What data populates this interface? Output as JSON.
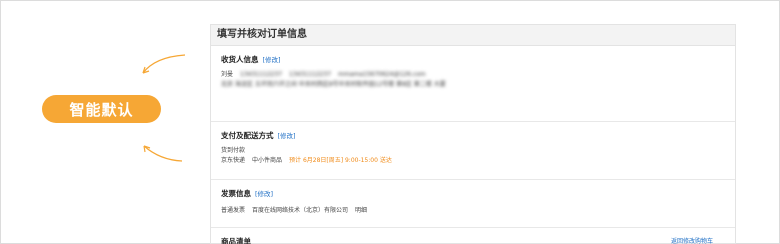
{
  "annotation": {
    "label": "智能默认"
  },
  "panel": {
    "title": "填写并核对订单信息"
  },
  "receiver": {
    "title": "收货人信息",
    "modify": "[修改]",
    "name": "刘曼",
    "phone1": "13431112237",
    "phone2": "13431112237",
    "email": "mmama15670624@126.com",
    "address": "北京 海淀区 五环到六环之间 中关村西区8号中关村软件园12号楼 第8区 第二楼 大厦"
  },
  "payment": {
    "title": "支付及配送方式",
    "modify": "[修改]",
    "pay_method": "货到付款",
    "carrier": "京东快递",
    "goods_type": "中小件商品",
    "eta": "预计 6月28日[周五] 9:00-15:00 送达"
  },
  "invoice": {
    "title": "发票信息",
    "modify": "[修改]",
    "type": "普通发票",
    "company": "百度在线网络技术（北京）有限公司",
    "detail": "明细"
  },
  "goods": {
    "title": "商品清单",
    "back_link": "返回修改购物车"
  },
  "colors": {
    "accent": "#f6a735",
    "link": "#1f6fc5",
    "highlight": "#f08a17"
  }
}
